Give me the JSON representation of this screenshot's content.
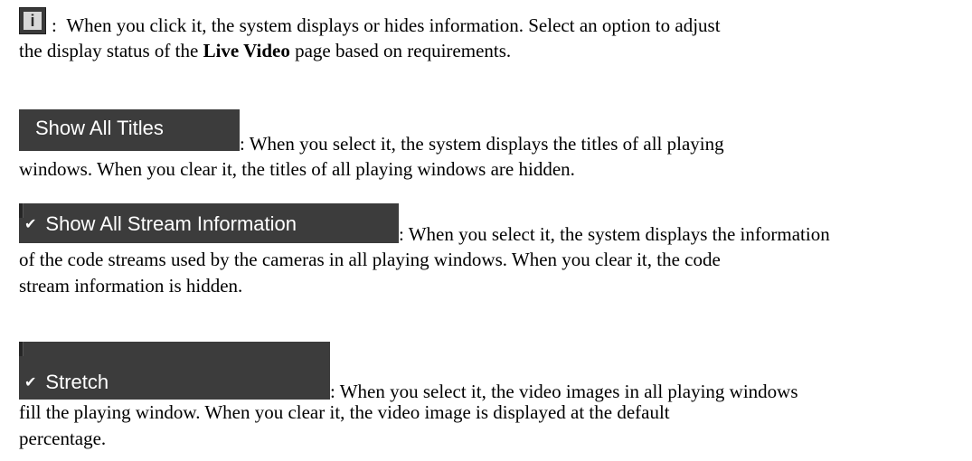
{
  "info": {
    "icon_glyph": "i",
    "icon_name": "info-icon",
    "sep": ":",
    "text1": "When you click it, the system displays or hides information. Select an option to adjust",
    "text2_pre": "the display status of the ",
    "text2_bold": "Live Video",
    "text2_post": " page based on requirements."
  },
  "show_all_titles": {
    "button_label": "Show All Titles",
    "checked": false,
    "text1": ": When you select it, the system displays the titles of all playing",
    "text2": "windows. When you clear it, the titles of all playing windows are hidden."
  },
  "show_all_stream_info": {
    "check_glyph": "✔",
    "button_label": "Show All Stream Information",
    "checked": true,
    "text1": ": When you select it, the system displays the information",
    "text2": "of the code streams used by the cameras in all playing windows. When you clear it, the code",
    "text3": "stream information is hidden."
  },
  "stretch": {
    "check_glyph": "✔",
    "button_label": "Stretch",
    "checked": true,
    "text1": ": When you select it, the video images in all playing windows",
    "text2": "fill the playing window. When you clear it, the video image is displayed at the default",
    "text3": "percentage."
  },
  "colors": {
    "button_bg": "#3c3c3c",
    "button_text": "#ffffff",
    "body_text": "#000000"
  }
}
